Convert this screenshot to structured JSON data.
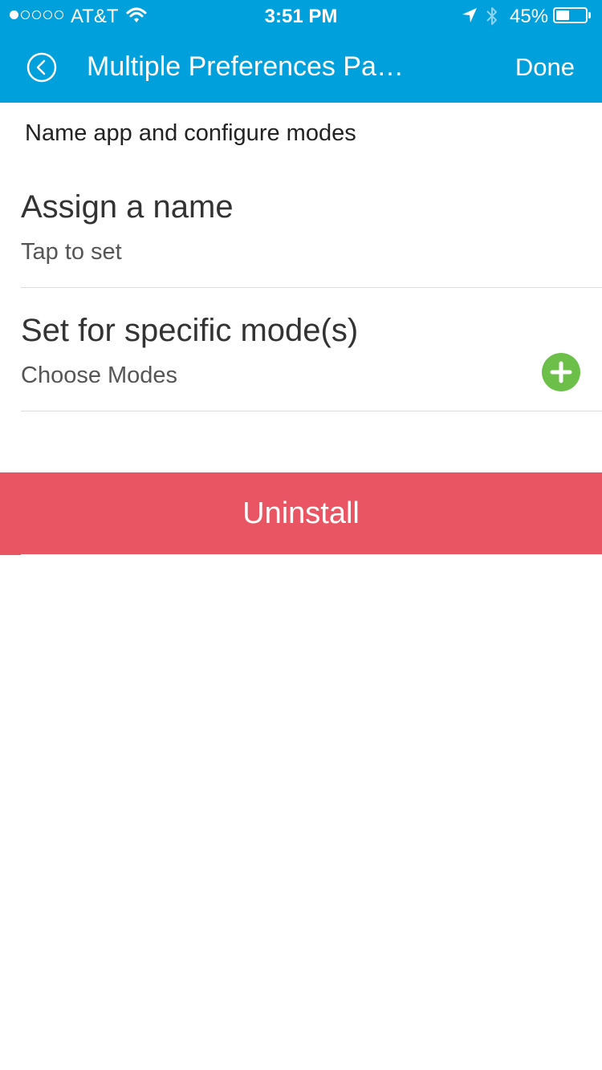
{
  "status_bar": {
    "carrier": "AT&T",
    "time": "3:51 PM",
    "battery_percent": "45%",
    "signal_strength": 1,
    "signal_max": 5,
    "battery_level": 0.45,
    "icons": [
      "wifi-icon",
      "location-icon",
      "bluetooth-icon",
      "battery-icon"
    ]
  },
  "nav": {
    "title": "Multiple Preferences Pa…",
    "done_label": "Done",
    "back_icon": "chevron-left-circle-icon"
  },
  "page": {
    "section_title": "Name app and configure modes",
    "rows": [
      {
        "label": "Assign a name",
        "value": "Tap to set"
      },
      {
        "label": "Set for specific mode(s)",
        "value": "Choose Modes",
        "action_icon": "plus-circle-icon"
      }
    ],
    "uninstall_label": "Uninstall"
  },
  "colors": {
    "header": "#00a0dc",
    "uninstall": "#e95563",
    "add_button": "#6cc04a"
  }
}
